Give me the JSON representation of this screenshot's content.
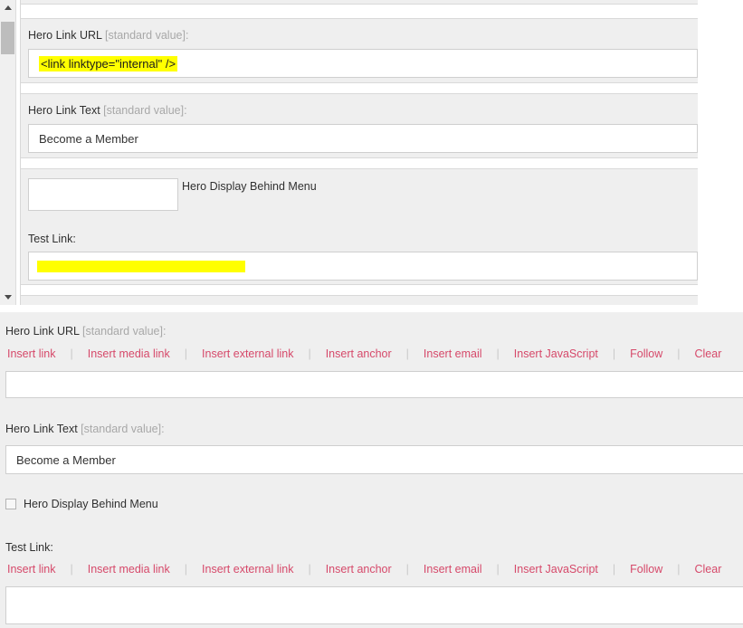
{
  "colors": {
    "panel_bg": "#efefef",
    "page_bg": "#ffffff",
    "link_red": "#d6496a",
    "highlight_yellow": "#ffff00",
    "label_dark": "#303030",
    "label_gray": "#a8a8a8",
    "border": "#cfcfcf",
    "scroll_thumb": "#bdbdbd"
  },
  "top_section": {
    "scrollbar": {
      "up_arrow": "scroll-up-arrow",
      "down_arrow": "scroll-down-arrow",
      "thumb": "scroll-thumb"
    },
    "fields": [
      {
        "label_main": "Hero Link URL",
        "label_std": "[standard value]:",
        "value": "<link linktype=\"internal\" />",
        "highlighted": true
      },
      {
        "label_main": "Hero Link Text",
        "label_std": "[standard value]:",
        "value": "Become a Member",
        "highlighted": false
      }
    ],
    "checkbox_field": {
      "label": "Hero Display Behind Menu",
      "checked": false
    },
    "test_link": {
      "label": "Test Link:",
      "value": "",
      "redacted": true
    }
  },
  "bottom_section": {
    "link_actions": [
      "Insert link",
      "Insert media link",
      "Insert external link",
      "Insert anchor",
      "Insert email",
      "Insert JavaScript",
      "Follow",
      "Clear"
    ],
    "separator": "|",
    "hero_link_url": {
      "label_main": "Hero Link URL",
      "label_std": "[standard value]:",
      "value": ""
    },
    "hero_link_text": {
      "label_main": "Hero Link Text",
      "label_std": "[standard value]:",
      "value": "Become a Member"
    },
    "checkbox_field": {
      "label": "Hero Display Behind Menu",
      "checked": false
    },
    "test_link": {
      "label": "Test Link:",
      "value": ""
    }
  }
}
